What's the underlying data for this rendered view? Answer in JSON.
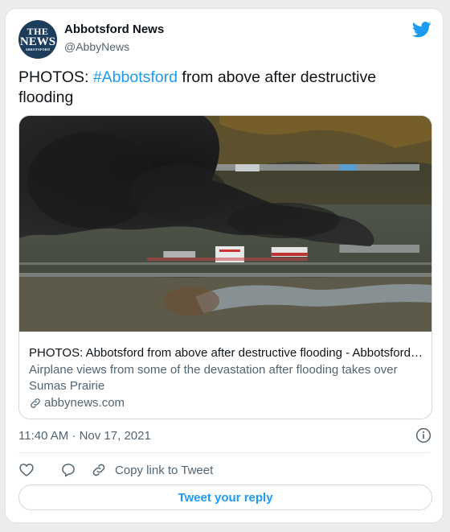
{
  "account": {
    "avatar_text": [
      "THE",
      "NEWS",
      "ABBOTSFORD"
    ],
    "name": "Abbotsford News",
    "handle": "@AbbyNews"
  },
  "tweet": {
    "text_before": "PHOTOS: ",
    "hashtag": "#Abbotsford",
    "text_after": " from above after destructive flooding"
  },
  "link_card": {
    "title": "PHOTOS: Abbotsford from above after destructive flooding - Abbotsford News",
    "description": "Airplane views from some of the devastation after flooding takes over Sumas Prairie",
    "domain": "abbynews.com"
  },
  "meta": {
    "timestamp": "11:40 AM · Nov 17, 2021"
  },
  "actions": {
    "like_icon": "heart-icon",
    "reply_icon": "speech-bubble-icon",
    "copy_link_label": "Copy link to Tweet",
    "reply_button_label": "Tweet your reply"
  },
  "colors": {
    "link_blue": "#1d9bf0",
    "secondary_text": "#536471",
    "avatar_bg": "#1d3d5c"
  }
}
